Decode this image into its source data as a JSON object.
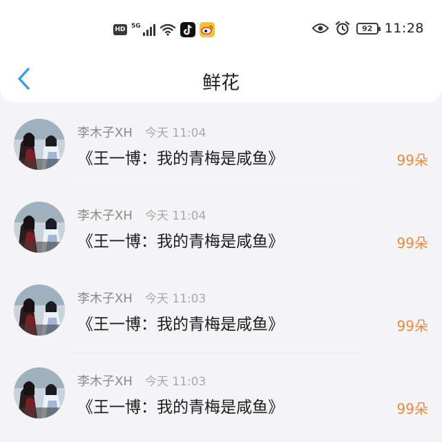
{
  "status_bar": {
    "hd_label": "HD",
    "network_label": "5G",
    "battery_level": "92",
    "time": "11:28"
  },
  "nav": {
    "title": "鲜花"
  },
  "items": [
    {
      "user": "李木子XH",
      "time": "今天 11:04",
      "book": "《王一博：我的青梅是咸鱼》",
      "amount": "99朵"
    },
    {
      "user": "李木子XH",
      "time": "今天 11:04",
      "book": "《王一博：我的青梅是咸鱼》",
      "amount": "99朵"
    },
    {
      "user": "李木子XH",
      "time": "今天 11:03",
      "book": "《王一博：我的青梅是咸鱼》",
      "amount": "99朵"
    },
    {
      "user": "李木子XH",
      "time": "今天 11:03",
      "book": "《王一博：我的青梅是咸鱼》",
      "amount": "99朵"
    }
  ],
  "colors": {
    "accent_back": "#3a9be8",
    "amount": "#e88a3c"
  }
}
